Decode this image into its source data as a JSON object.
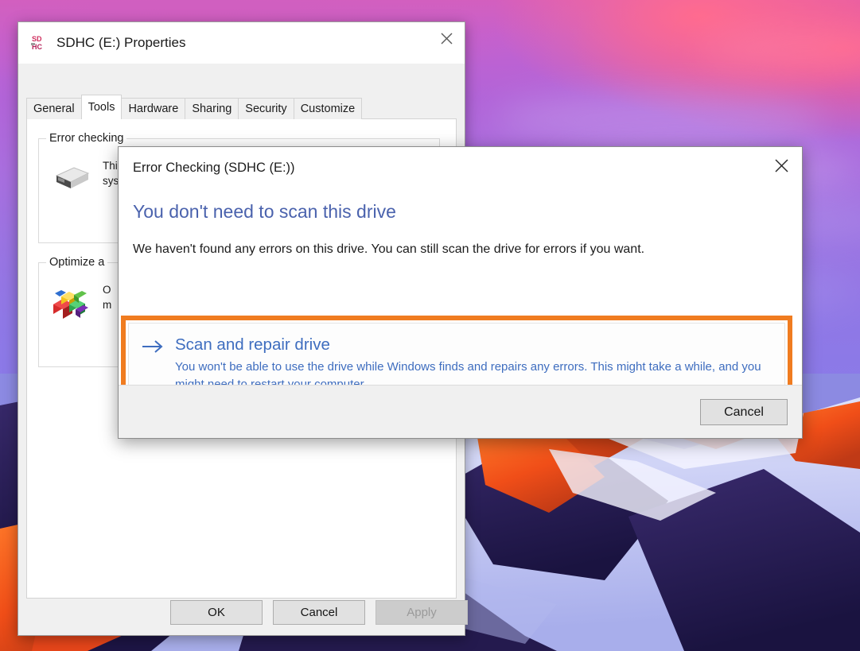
{
  "desktop": {
    "wallpaper_name": "mountain-sunset-wallpaper",
    "sky_top_color": "#d45fbe",
    "sky_bottom_color": "#8478e6",
    "mountain_sunlit_color": "#f04e18",
    "mountain_shadow_color": "#241a4e",
    "snow_color": "#cfd4f5"
  },
  "properties_window": {
    "icon_name": "sdhc-card-icon",
    "icon_label_top": "SD",
    "icon_label_bottom": "HC",
    "title": "SDHC (E:) Properties",
    "close_label": "Close",
    "tabs": [
      {
        "label": "General",
        "active": false
      },
      {
        "label": "Tools",
        "active": true
      },
      {
        "label": "Hardware",
        "active": false
      },
      {
        "label": "Sharing",
        "active": false
      },
      {
        "label": "Security",
        "active": false
      },
      {
        "label": "Customize",
        "active": false
      }
    ],
    "groups": [
      {
        "legend": "Error checking",
        "icon_name": "hard-drive-icon",
        "text_line1": "This option will check the drive for file",
        "text_line2": "system errors."
      },
      {
        "legend": "Optimize a",
        "icon_name": "defragment-icon",
        "text_line1": "O",
        "text_line2": "m"
      }
    ],
    "buttons": {
      "ok": "OK",
      "cancel": "Cancel",
      "apply": "Apply",
      "apply_disabled": true
    }
  },
  "error_checking_dialog": {
    "title": "Error Checking (SDHC (E:))",
    "close_label": "Close",
    "heading": "You don't need to scan this drive",
    "heading_color": "#4a62ad",
    "subtext": "We haven't found any errors on this drive. You can still scan the drive for errors if you want.",
    "highlight_color": "#f07c20",
    "option": {
      "arrow_icon": "arrow-right-icon",
      "title": "Scan and repair drive",
      "description": "You won't be able to use the drive while Windows finds and repairs any errors. This might take a while, and you might need to restart your computer.",
      "link_color": "#3e6dbf"
    },
    "cancel_label": "Cancel"
  }
}
